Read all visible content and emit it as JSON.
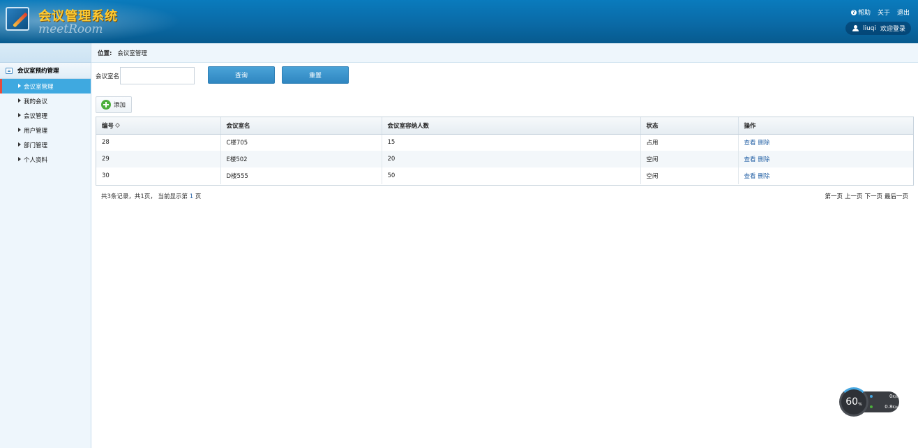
{
  "header": {
    "title": "会议管理系统",
    "subtitle": "meetRoom",
    "links": {
      "help": "帮助",
      "about": "关于",
      "logout": "退出"
    },
    "user": {
      "name": "liuqi",
      "welcome": "欢迎登录"
    }
  },
  "sidebar": {
    "group": "会议室预约管理",
    "items": [
      {
        "label": "会议室管理",
        "active": true
      },
      {
        "label": "我的会议"
      },
      {
        "label": "会议管理"
      },
      {
        "label": "用户管理"
      },
      {
        "label": "部门管理"
      },
      {
        "label": "个人资料"
      }
    ]
  },
  "breadcrumb": {
    "label": "位置:",
    "value": "会议室管理"
  },
  "search": {
    "label": "会议室名:",
    "value": "",
    "query_button": "查询",
    "reset_button": "重置",
    "add_button": "添加"
  },
  "table": {
    "headers": [
      "编号",
      "会议室名",
      "会议室容纳人数",
      "状态",
      "操作"
    ],
    "rows": [
      {
        "id": "28",
        "name": "C楼705",
        "capacity": "15",
        "status": "占用"
      },
      {
        "id": "29",
        "name": "E楼502",
        "capacity": "20",
        "status": "空闲"
      },
      {
        "id": "30",
        "name": "D楼555",
        "capacity": "50",
        "status": "空闲"
      }
    ],
    "actions": {
      "view": "查看",
      "delete": "删除"
    }
  },
  "pager": {
    "summary_prefix": "共3条记录，共1页，  当前显示第",
    "current": "1",
    "summary_suffix": "页",
    "first": "第一页",
    "prev": "上一页",
    "next": "下一页",
    "last": "最后一页"
  },
  "widget": {
    "percent": "60",
    "percent_unit": "%",
    "up": "0",
    "down": "0.8",
    "rate_unit": "K/s"
  },
  "colors": {
    "header": "#0a6aa6",
    "accent": "#3fa9e0",
    "active_marker": "#e64b3c",
    "link": "#2b66a8"
  }
}
